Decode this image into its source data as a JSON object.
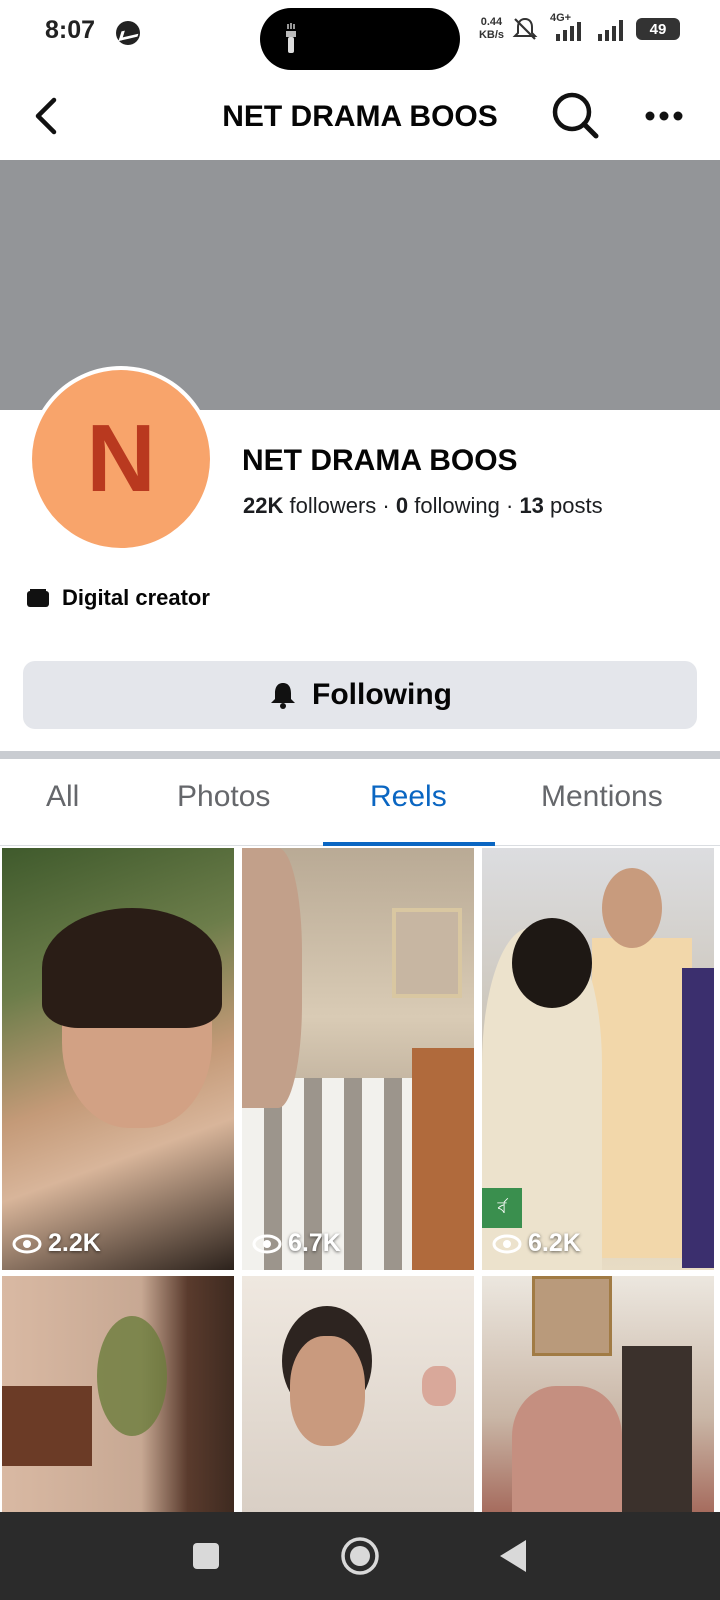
{
  "status_bar": {
    "time": "8:07",
    "net_speed_value": "0.44",
    "net_speed_unit": "KB/s",
    "network": "4G+",
    "battery": "49"
  },
  "header": {
    "title": "NET DRAMA BOOS"
  },
  "profile": {
    "avatar_letter": "N",
    "avatar_bg": "#f8a46b",
    "avatar_fg": "#b9391f",
    "name": "NET DRAMA BOOS",
    "followers_count": "22K",
    "followers_label": "followers",
    "following_count": "0",
    "following_label": "following",
    "posts_count": "13",
    "posts_label": "posts",
    "separator": "·",
    "category": "Digital creator",
    "follow_button_label": "Following"
  },
  "tabs": [
    {
      "label": "All",
      "active": false
    },
    {
      "label": "Photos",
      "active": false
    },
    {
      "label": "Reels",
      "active": true
    },
    {
      "label": "Mentions",
      "active": false
    }
  ],
  "reels": [
    {
      "views": "2.2K"
    },
    {
      "views": "6.7K"
    },
    {
      "views": "6.2K"
    },
    {
      "views": ""
    },
    {
      "views": ""
    },
    {
      "views": ""
    }
  ],
  "reel_badge_text": "র্ব",
  "colors": {
    "accent": "#0a66c2",
    "cover": "#939598",
    "button_bg": "#e4e6eb"
  }
}
